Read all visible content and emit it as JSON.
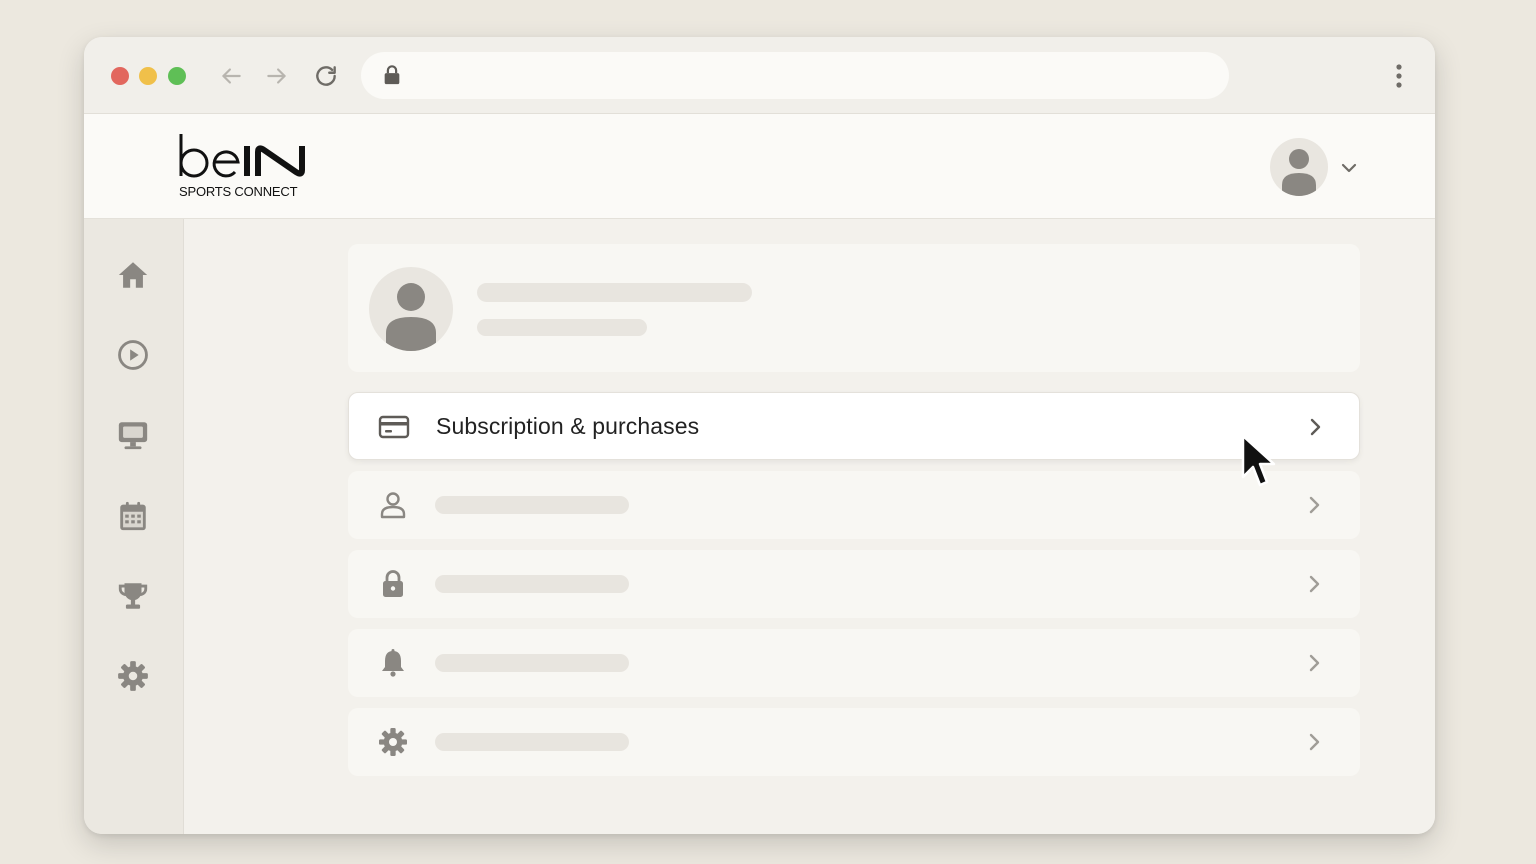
{
  "browser": {
    "traffic_lights": [
      "close",
      "minimize",
      "maximize"
    ],
    "nav_icons": [
      "arrow-left-icon",
      "arrow-right-icon",
      "reload-icon"
    ],
    "address_icon": "lock-icon",
    "menu_icon": "more-vert-icon"
  },
  "header": {
    "logo_text": "beIN",
    "logo_subtitle": "SPORTS CONNECT",
    "account_icon": "person-icon"
  },
  "sidebar": {
    "items": [
      {
        "icon": "home-icon"
      },
      {
        "icon": "play-circle-icon"
      },
      {
        "icon": "tv-icon"
      },
      {
        "icon": "calendar-icon"
      },
      {
        "icon": "trophy-icon"
      },
      {
        "icon": "settings-icon"
      }
    ]
  },
  "settings": {
    "rows": [
      {
        "icon": "credit-card-icon",
        "label": "Subscription & purchases",
        "active": true
      },
      {
        "icon": "person-icon",
        "label": null
      },
      {
        "icon": "lock-icon",
        "label": null
      },
      {
        "icon": "bell-icon",
        "label": null
      },
      {
        "icon": "gear-icon",
        "label": null
      }
    ]
  },
  "colors": {
    "page_bg": "#ece8df",
    "window_bg": "#f3f1ec",
    "icon_gray": "#8a8782",
    "skeleton": "#e8e5df",
    "text_dark": "#222222"
  }
}
